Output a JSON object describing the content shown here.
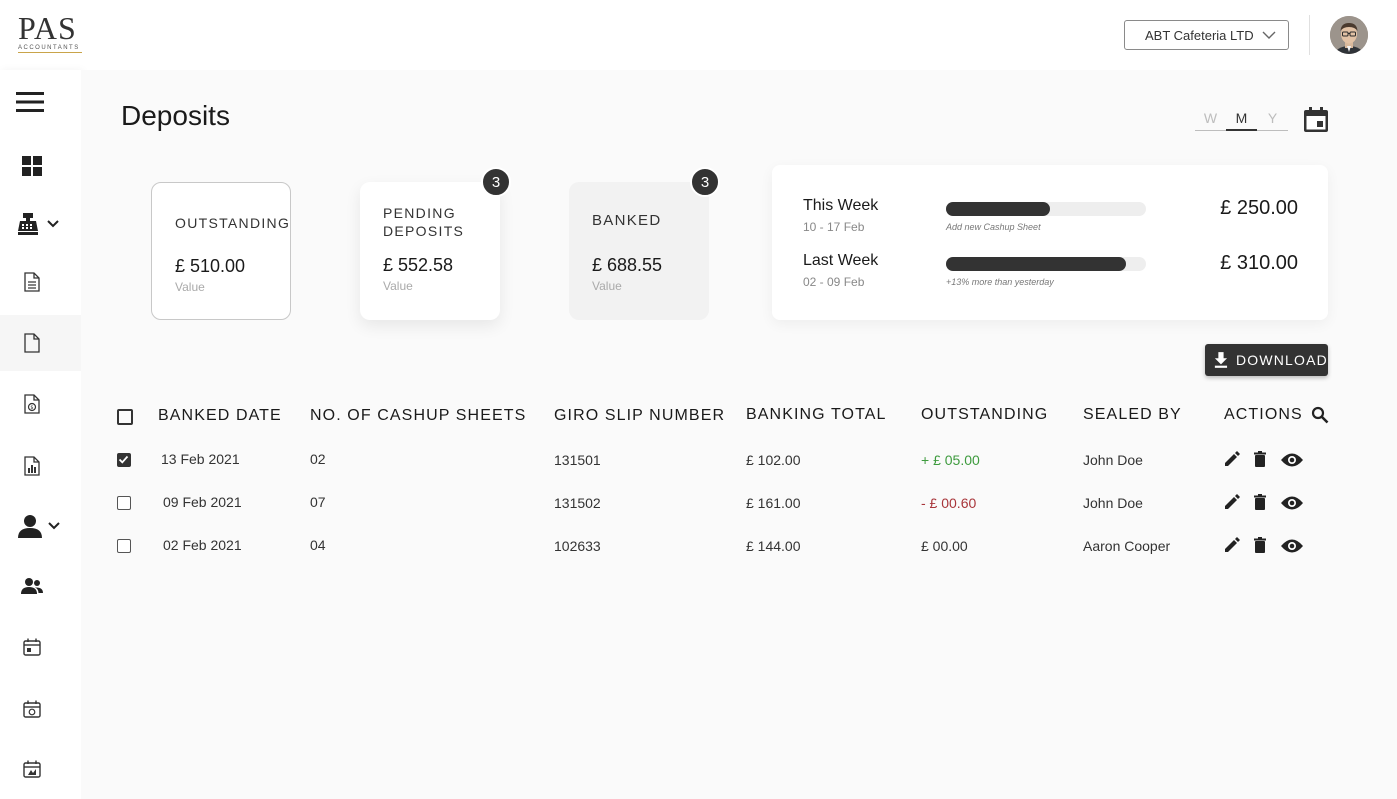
{
  "header": {
    "logo_text": "PAS",
    "logo_subtext": "ACCOUNTANTS",
    "company_selector": "ABT Cafeteria LTD",
    "avatar_icon": "user-avatar"
  },
  "sidebar": {
    "items": [
      {
        "icon": "menu-icon"
      },
      {
        "icon": "dashboard-icon"
      },
      {
        "icon": "cash-register-icon"
      },
      {
        "icon": "document-icon"
      },
      {
        "icon": "file-icon"
      },
      {
        "icon": "money-file-icon"
      },
      {
        "icon": "report-file-icon"
      },
      {
        "icon": "person-icon"
      },
      {
        "icon": "people-icon"
      },
      {
        "icon": "calendar-icon"
      },
      {
        "icon": "calendar-check-icon"
      },
      {
        "icon": "calendar-alert-icon"
      }
    ]
  },
  "page": {
    "title": "Deposits",
    "period_toggle": [
      "W",
      "M",
      "Y"
    ],
    "period_selected": "M"
  },
  "cards": {
    "outstanding": {
      "title": "OUTSTANDING",
      "amount": "£ 510.00",
      "sub": "Value"
    },
    "pending": {
      "title": "PENDING DEPOSITS",
      "amount": "£ 552.58",
      "sub": "Value",
      "badge": "3"
    },
    "banked": {
      "title": "BANKED",
      "amount": "£ 688.55",
      "sub": "Value",
      "badge": "3"
    }
  },
  "weeks": [
    {
      "label": "This Week",
      "range": "10 - 17 Feb",
      "note": "Add new Cashup Sheet",
      "amount": "£ 250.00",
      "progress": 0.52
    },
    {
      "label": "Last Week",
      "range": "02 - 09 Feb",
      "note": "+13% more than yesterday",
      "amount": "£ 310.00",
      "progress": 0.9
    }
  ],
  "download_label": "DOWNLOAD",
  "table": {
    "headers": [
      "BANKED DATE",
      "NO. OF CASHUP SHEETS",
      "GIRO SLIP NUMBER",
      "BANKING TOTAL",
      "OUTSTANDING",
      "SEALED BY",
      "ACTIONS"
    ],
    "rows": [
      {
        "checked": true,
        "date": "13 Feb 2021",
        "sheets": "02",
        "giro": "131501",
        "total": "£ 102.00",
        "outstanding": "+ £ 05.00",
        "status": "positive",
        "sealed_by": "John Doe"
      },
      {
        "checked": false,
        "date": "09 Feb 2021",
        "sheets": "07",
        "giro": "131502",
        "total": "£ 161.00",
        "outstanding": "- £ 00.60",
        "status": "negative",
        "sealed_by": "John Doe"
      },
      {
        "checked": false,
        "date": "02 Feb 2021",
        "sheets": "04",
        "giro": "102633",
        "total": "£ 144.00",
        "outstanding": "£ 00.00",
        "status": "neutral",
        "sealed_by": "Aaron Cooper"
      }
    ]
  },
  "colors": {
    "accent_dark": "#333333",
    "positive": "#3e9b3e",
    "negative": "#a8353a",
    "logo_gold": "#c9a44a"
  }
}
